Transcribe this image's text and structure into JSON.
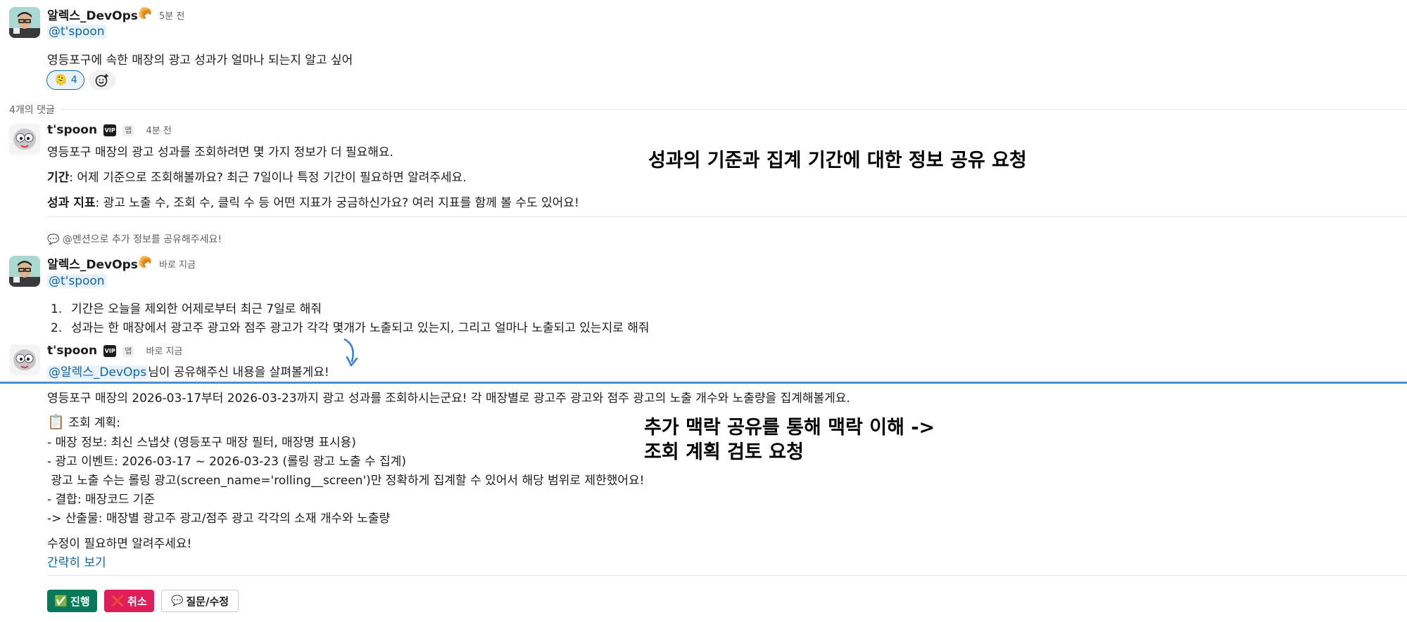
{
  "messages": {
    "m1": {
      "author": "알렉스_DevOps",
      "author_emoji": "🥐",
      "time": "5분 전",
      "mention": "@t'spoon",
      "text": "영등포구에 속한 매장의 광고 성과가 얼마나 되는지 알고 싶어"
    },
    "reaction": {
      "emoji": "🫠",
      "count": "4"
    },
    "thread_count": "4개의 댓글",
    "m2": {
      "author": "t'spoon",
      "vip": "VIP",
      "app": "앱",
      "time": "4분 전",
      "line1": "영등포구 매장의 광고 성과를 조회하려면 몇 가지 정보가 더 필요해요.",
      "line2_label": "기간",
      "line2_text": ": 어제 기준으로 조회해볼까요? 최근 7일이나 특정 기간이 필요하면 알려주세요.",
      "line3_label": "성과 지표",
      "line3_text": ": 광고 노출 수, 조회 수, 클릭 수 등 어떤 지표가 궁금하신가요? 여러 지표를 함께 볼 수도 있어요!",
      "hint": "@멘션으로 추가 정보를 공유해주세요!"
    },
    "m3": {
      "author": "알렉스_DevOps",
      "author_emoji": "🥐",
      "time": "바로 지금",
      "mention": "@t'spoon",
      "items": [
        {
          "num": "1.",
          "text": "기간은 오늘을 제외한 어제로부터 최근 7일로 해줘"
        },
        {
          "num": "2.",
          "text": "성과는 한 매장에서 광고주 광고와 점주 광고가 각각 몇개가 노출되고 있는지, 그리고 얼마나 노출되고 있는지로 해줘"
        }
      ]
    },
    "m4": {
      "author": "t'spoon",
      "vip": "VIP",
      "app": "앱",
      "time": "바로 지금",
      "mention": "@알렉스_DevOps",
      "mention_tail": "님이 공유해주신 내용을 살펴볼게요!",
      "intro": "영등포구 매장의 2026-03-17부터 2026-03-23까지 광고 성과를 조회하시는군요! 각 매장별로 광고주 광고와 점주 광고의 노출 개수와 노출량을 집계해볼게요.",
      "plan_title": "조회 계획:",
      "plan_lines": [
        "- 매장 정보: 최신 스냅샷 (영등포구 매장 필터, 매장명 표시용)",
        "- 광고 이벤트: 2026-03-17 ~ 2026-03-23 (롤링 광고 노출 수 집계)",
        " 광고 노출 수는 롤링 광고(screen_name='rolling__screen')만 정확하게 집계할 수 있어서 해당 범위로 제한했어요!",
        "- 결합: 매장코드 기준",
        "-> 산출물: 매장별 광고주 광고/점주 광고 각각의 소재 개수와 노출량"
      ],
      "closing": "수정이 필요하면 알려주세요!",
      "collapse_link": "간략히 보기"
    }
  },
  "buttons": {
    "proceed": "진행",
    "cancel": "취소",
    "question": "질문/수정"
  },
  "annotations": {
    "a1": "성과의 기준과 집계 기간에 대한 정보 공유 요청",
    "a2_line1": "추가 맥락 공유를 통해 맥락 이해 ->",
    "a2_line2": "조회 계획 검토 요청"
  },
  "colors": {
    "link": "#1264a3",
    "divider": "#4a90d9",
    "proceed_bg": "#007a5a",
    "cancel_bg": "#e01e5a"
  }
}
